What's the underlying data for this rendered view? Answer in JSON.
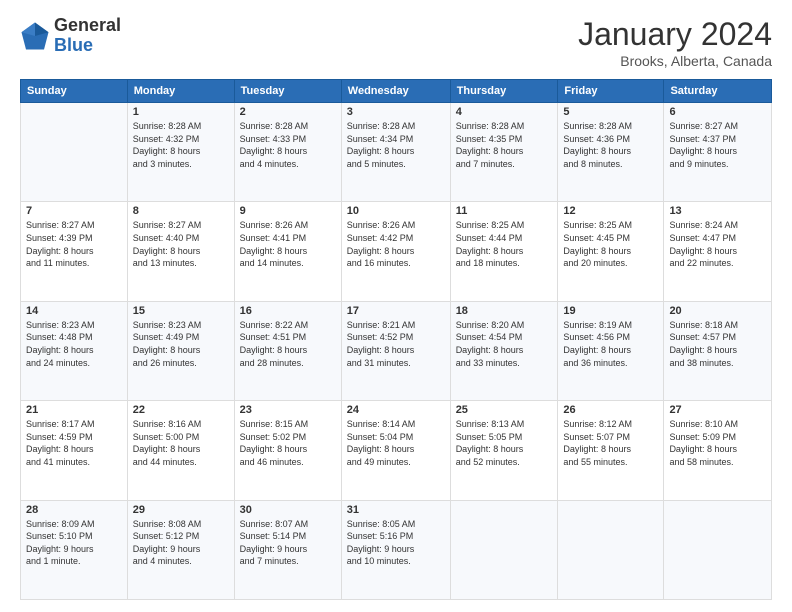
{
  "header": {
    "logo": {
      "general": "General",
      "blue": "Blue"
    },
    "title": "January 2024",
    "location": "Brooks, Alberta, Canada"
  },
  "weekdays": [
    "Sunday",
    "Monday",
    "Tuesday",
    "Wednesday",
    "Thursday",
    "Friday",
    "Saturday"
  ],
  "weeks": [
    [
      {
        "day": "",
        "info": ""
      },
      {
        "day": "1",
        "info": "Sunrise: 8:28 AM\nSunset: 4:32 PM\nDaylight: 8 hours\nand 3 minutes."
      },
      {
        "day": "2",
        "info": "Sunrise: 8:28 AM\nSunset: 4:33 PM\nDaylight: 8 hours\nand 4 minutes."
      },
      {
        "day": "3",
        "info": "Sunrise: 8:28 AM\nSunset: 4:34 PM\nDaylight: 8 hours\nand 5 minutes."
      },
      {
        "day": "4",
        "info": "Sunrise: 8:28 AM\nSunset: 4:35 PM\nDaylight: 8 hours\nand 7 minutes."
      },
      {
        "day": "5",
        "info": "Sunrise: 8:28 AM\nSunset: 4:36 PM\nDaylight: 8 hours\nand 8 minutes."
      },
      {
        "day": "6",
        "info": "Sunrise: 8:27 AM\nSunset: 4:37 PM\nDaylight: 8 hours\nand 9 minutes."
      }
    ],
    [
      {
        "day": "7",
        "info": "Sunrise: 8:27 AM\nSunset: 4:39 PM\nDaylight: 8 hours\nand 11 minutes."
      },
      {
        "day": "8",
        "info": "Sunrise: 8:27 AM\nSunset: 4:40 PM\nDaylight: 8 hours\nand 13 minutes."
      },
      {
        "day": "9",
        "info": "Sunrise: 8:26 AM\nSunset: 4:41 PM\nDaylight: 8 hours\nand 14 minutes."
      },
      {
        "day": "10",
        "info": "Sunrise: 8:26 AM\nSunset: 4:42 PM\nDaylight: 8 hours\nand 16 minutes."
      },
      {
        "day": "11",
        "info": "Sunrise: 8:25 AM\nSunset: 4:44 PM\nDaylight: 8 hours\nand 18 minutes."
      },
      {
        "day": "12",
        "info": "Sunrise: 8:25 AM\nSunset: 4:45 PM\nDaylight: 8 hours\nand 20 minutes."
      },
      {
        "day": "13",
        "info": "Sunrise: 8:24 AM\nSunset: 4:47 PM\nDaylight: 8 hours\nand 22 minutes."
      }
    ],
    [
      {
        "day": "14",
        "info": "Sunrise: 8:23 AM\nSunset: 4:48 PM\nDaylight: 8 hours\nand 24 minutes."
      },
      {
        "day": "15",
        "info": "Sunrise: 8:23 AM\nSunset: 4:49 PM\nDaylight: 8 hours\nand 26 minutes."
      },
      {
        "day": "16",
        "info": "Sunrise: 8:22 AM\nSunset: 4:51 PM\nDaylight: 8 hours\nand 28 minutes."
      },
      {
        "day": "17",
        "info": "Sunrise: 8:21 AM\nSunset: 4:52 PM\nDaylight: 8 hours\nand 31 minutes."
      },
      {
        "day": "18",
        "info": "Sunrise: 8:20 AM\nSunset: 4:54 PM\nDaylight: 8 hours\nand 33 minutes."
      },
      {
        "day": "19",
        "info": "Sunrise: 8:19 AM\nSunset: 4:56 PM\nDaylight: 8 hours\nand 36 minutes."
      },
      {
        "day": "20",
        "info": "Sunrise: 8:18 AM\nSunset: 4:57 PM\nDaylight: 8 hours\nand 38 minutes."
      }
    ],
    [
      {
        "day": "21",
        "info": "Sunrise: 8:17 AM\nSunset: 4:59 PM\nDaylight: 8 hours\nand 41 minutes."
      },
      {
        "day": "22",
        "info": "Sunrise: 8:16 AM\nSunset: 5:00 PM\nDaylight: 8 hours\nand 44 minutes."
      },
      {
        "day": "23",
        "info": "Sunrise: 8:15 AM\nSunset: 5:02 PM\nDaylight: 8 hours\nand 46 minutes."
      },
      {
        "day": "24",
        "info": "Sunrise: 8:14 AM\nSunset: 5:04 PM\nDaylight: 8 hours\nand 49 minutes."
      },
      {
        "day": "25",
        "info": "Sunrise: 8:13 AM\nSunset: 5:05 PM\nDaylight: 8 hours\nand 52 minutes."
      },
      {
        "day": "26",
        "info": "Sunrise: 8:12 AM\nSunset: 5:07 PM\nDaylight: 8 hours\nand 55 minutes."
      },
      {
        "day": "27",
        "info": "Sunrise: 8:10 AM\nSunset: 5:09 PM\nDaylight: 8 hours\nand 58 minutes."
      }
    ],
    [
      {
        "day": "28",
        "info": "Sunrise: 8:09 AM\nSunset: 5:10 PM\nDaylight: 9 hours\nand 1 minute."
      },
      {
        "day": "29",
        "info": "Sunrise: 8:08 AM\nSunset: 5:12 PM\nDaylight: 9 hours\nand 4 minutes."
      },
      {
        "day": "30",
        "info": "Sunrise: 8:07 AM\nSunset: 5:14 PM\nDaylight: 9 hours\nand 7 minutes."
      },
      {
        "day": "31",
        "info": "Sunrise: 8:05 AM\nSunset: 5:16 PM\nDaylight: 9 hours\nand 10 minutes."
      },
      {
        "day": "",
        "info": ""
      },
      {
        "day": "",
        "info": ""
      },
      {
        "day": "",
        "info": ""
      }
    ]
  ]
}
